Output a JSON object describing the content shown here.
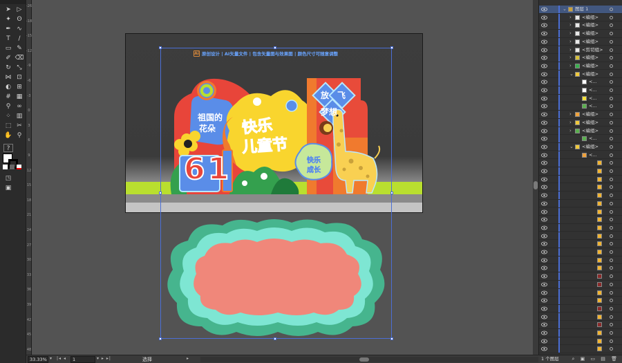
{
  "artwork": {
    "banner_badge": "Ai",
    "banner_text": "原创设计 | AI矢量文件 | 包含矢量图与效果图 | 颜色尺寸可随意调整",
    "title_main_1": "快乐",
    "title_main_2": "儿童节",
    "text_motherland_1": "祖国的",
    "text_motherland_2": "花朵",
    "text_fly_1": "放",
    "text_fly_2": "飞",
    "text_dream": "梦想",
    "text_happy_1": "快乐",
    "text_happy_2": "成长",
    "big_number": "61",
    "colors": {
      "coral": "#f0877a",
      "teal": "#7ee6d3",
      "green": "#46b58e",
      "lime": "#b9df2f",
      "yellow": "#f9d52e",
      "blue": "#5a8de8",
      "orange": "#f07a2e"
    }
  },
  "layers": {
    "items": [
      {
        "name": "图层 1",
        "level": 0,
        "expanded": true,
        "selected": true,
        "thumb": "#c9a13a"
      },
      {
        "name": "<编组>",
        "level": 1,
        "thumb": "#e8e8e8"
      },
      {
        "name": "<编组>",
        "level": 1,
        "thumb": "#e8e8e8"
      },
      {
        "name": "<编组>",
        "level": 1,
        "thumb": "#e8e8e8"
      },
      {
        "name": "<编组>",
        "level": 1,
        "thumb": "#e8e8e8"
      },
      {
        "name": "<剪切组>",
        "level": 1,
        "thumb": "#e8e8e8"
      },
      {
        "name": "<编组>",
        "level": 1,
        "thumb": "#d6c03a"
      },
      {
        "name": "<编组>",
        "level": 1,
        "thumb": "#3ab04e"
      },
      {
        "name": "<编组>",
        "level": 1,
        "expanded": true,
        "thumb": "#f0c93a"
      },
      {
        "name": "<...",
        "level": 2,
        "thumb": "#ffffff"
      },
      {
        "name": "<...",
        "level": 2,
        "thumb": "#ffffff"
      },
      {
        "name": "<...",
        "level": 2,
        "thumb": "#f3e03a"
      },
      {
        "name": "<...",
        "level": 2,
        "thumb": "#5ab04e"
      },
      {
        "name": "<编组>",
        "level": 1,
        "thumb": "#f0a13a"
      },
      {
        "name": "<编组>",
        "level": 1,
        "thumb": "#f0c93a"
      },
      {
        "name": "<编组>",
        "level": 1,
        "thumb": "#5ab04e"
      },
      {
        "name": "<...",
        "level": 2,
        "thumb": "#5ab04e"
      },
      {
        "name": "<编组>",
        "level": 1,
        "expanded": true,
        "thumb": "#f0c93a"
      },
      {
        "name": "<...",
        "level": 2,
        "thumb": "#f0a13a"
      },
      {
        "name": "",
        "level": 3,
        "thumb": "#f2b430"
      },
      {
        "name": "",
        "level": 3,
        "thumb": "#f2b430"
      },
      {
        "name": "",
        "level": 3,
        "thumb": "#f2b430"
      },
      {
        "name": "",
        "level": 3,
        "thumb": "#f2b430"
      },
      {
        "name": "",
        "level": 3,
        "thumb": "#f2b430"
      },
      {
        "name": "",
        "level": 3,
        "thumb": "#f2b430"
      },
      {
        "name": "",
        "level": 3,
        "thumb": "#f2b430"
      },
      {
        "name": "",
        "level": 3,
        "thumb": "#f2b430"
      },
      {
        "name": "",
        "level": 3,
        "thumb": "#f2b430"
      },
      {
        "name": "",
        "level": 3,
        "thumb": "#f2b430"
      },
      {
        "name": "",
        "level": 3,
        "thumb": "#f2b430"
      },
      {
        "name": "",
        "level": 3,
        "thumb": "#f2b430"
      },
      {
        "name": "",
        "level": 3,
        "thumb": "#f2b430"
      },
      {
        "name": "",
        "level": 3,
        "thumb": "#f2b430"
      },
      {
        "name": "",
        "level": 3,
        "thumb": "#8a2a2a"
      },
      {
        "name": "",
        "level": 3,
        "thumb": "#8a2a2a"
      },
      {
        "name": "",
        "level": 3,
        "thumb": "#f2b430"
      },
      {
        "name": "",
        "level": 3,
        "thumb": "#f2b430"
      },
      {
        "name": "",
        "level": 3,
        "thumb": "#8a2a2a"
      },
      {
        "name": "",
        "level": 3,
        "thumb": "#f2b430"
      },
      {
        "name": "",
        "level": 3,
        "thumb": "#8a2a2a"
      },
      {
        "name": "",
        "level": 3,
        "thumb": "#f2b430"
      },
      {
        "name": "",
        "level": 3,
        "thumb": "#f2b430"
      },
      {
        "name": "",
        "level": 3,
        "thumb": "#f2b430"
      }
    ],
    "footer_count": "1 个图层"
  },
  "statusbar": {
    "zoom": "33.33%",
    "artboard_number": "1",
    "tool_name": "选择"
  },
  "ruler": {
    "ticks": [
      "-26",
      "-18",
      "-15",
      "-12",
      "-9",
      "-6",
      "-3",
      "0",
      "3",
      "6",
      "9",
      "12",
      "15",
      "18",
      "21",
      "24",
      "27",
      "30",
      "33",
      "36",
      "39",
      "42",
      "45",
      "48"
    ]
  }
}
